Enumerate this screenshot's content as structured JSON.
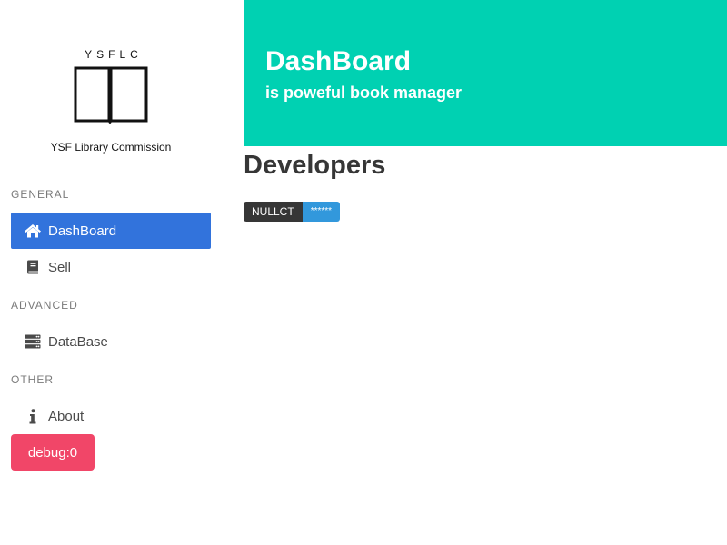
{
  "brand": {
    "top_text": "YSFLC",
    "name": "YSF Library Commission",
    "logo_icon": "open-book-icon"
  },
  "sidebar": {
    "sections": [
      {
        "label": "GENERAL",
        "items": [
          {
            "label": "DashBoard",
            "icon": "home-icon",
            "active": true
          },
          {
            "label": "Sell",
            "icon": "book-icon",
            "active": false
          }
        ]
      },
      {
        "label": "ADVANCED",
        "items": [
          {
            "label": "DataBase",
            "icon": "server-icon",
            "active": false
          }
        ]
      },
      {
        "label": "OTHER",
        "items": [
          {
            "label": "About",
            "icon": "info-icon",
            "active": false
          }
        ]
      }
    ],
    "debug_button": "debug:0"
  },
  "hero": {
    "title": "DashBoard",
    "subtitle": "is poweful book manager"
  },
  "developers": {
    "heading": "Developers",
    "tags": [
      {
        "name": "NULLCT",
        "value": "******"
      }
    ]
  },
  "colors": {
    "primary": "#00d1b2",
    "link": "#3273dc",
    "danger": "#f14668",
    "dark": "#363636",
    "info": "#3298dc",
    "menu_label": "#7a7a7a"
  }
}
